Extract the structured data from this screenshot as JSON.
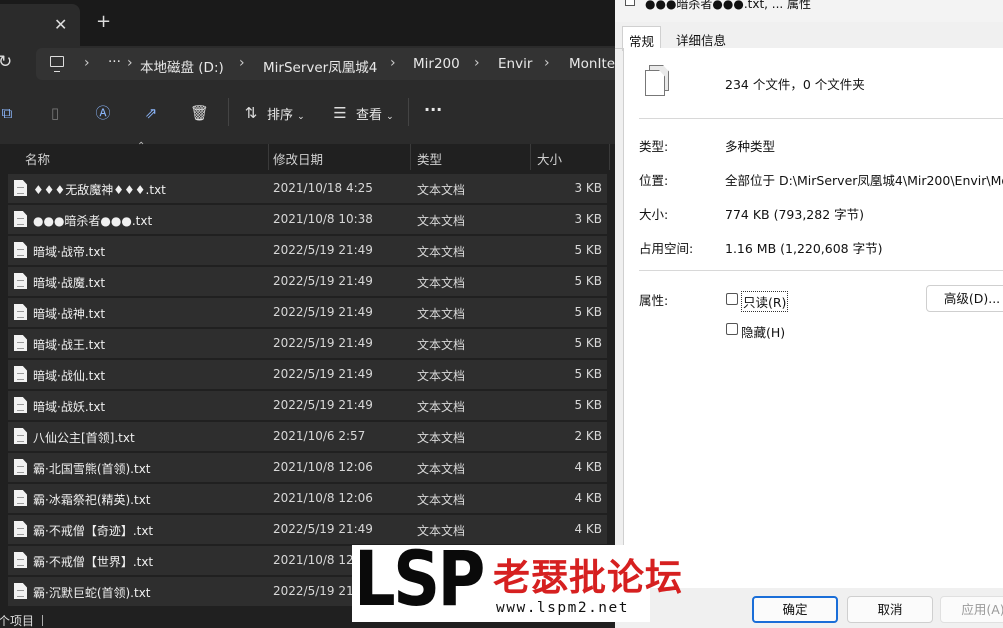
{
  "explorer": {
    "tab": {
      "close_glyph": "✕",
      "new_tab_glyph": "+"
    },
    "address": {
      "refresh_glyph": "↻",
      "more_glyph": "···",
      "crumbs": [
        "本地磁盘 (D:)",
        "MirServer凤凰城4",
        "Mir200",
        "Envir",
        "MonIte"
      ],
      "sep_glyph": "›"
    },
    "toolbar": {
      "sort_label": "排序",
      "view_label": "查看",
      "more_glyph": "···"
    },
    "columns": {
      "name": "名称",
      "date": "修改日期",
      "type": "类型",
      "size": "大小"
    },
    "files": [
      {
        "name": "♦♦♦无敌魔神♦♦♦.txt",
        "date": "2021/10/18 4:25",
        "type": "文本文档",
        "size": "3 KB"
      },
      {
        "name": "●●●暗杀者●●●.txt",
        "date": "2021/10/8 10:38",
        "type": "文本文档",
        "size": "3 KB"
      },
      {
        "name": "暗域·战帝.txt",
        "date": "2022/5/19 21:49",
        "type": "文本文档",
        "size": "5 KB"
      },
      {
        "name": "暗域·战魔.txt",
        "date": "2022/5/19 21:49",
        "type": "文本文档",
        "size": "5 KB"
      },
      {
        "name": "暗域·战神.txt",
        "date": "2022/5/19 21:49",
        "type": "文本文档",
        "size": "5 KB"
      },
      {
        "name": "暗域·战王.txt",
        "date": "2022/5/19 21:49",
        "type": "文本文档",
        "size": "5 KB"
      },
      {
        "name": "暗域·战仙.txt",
        "date": "2022/5/19 21:49",
        "type": "文本文档",
        "size": "5 KB"
      },
      {
        "name": "暗域·战妖.txt",
        "date": "2022/5/19 21:49",
        "type": "文本文档",
        "size": "5 KB"
      },
      {
        "name": "八仙公主[首领].txt",
        "date": "2021/10/6 2:57",
        "type": "文本文档",
        "size": "2 KB"
      },
      {
        "name": "霸·北国雪熊(首领).txt",
        "date": "2021/10/8 12:06",
        "type": "文本文档",
        "size": "4 KB"
      },
      {
        "name": "霸·冰霜祭祀(精英).txt",
        "date": "2021/10/8 12:06",
        "type": "文本文档",
        "size": "4 KB"
      },
      {
        "name": "霸·不戒僧【奇迹】.txt",
        "date": "2022/5/19 21:49",
        "type": "文本文档",
        "size": "4 KB"
      },
      {
        "name": "霸·不戒僧【世界】.txt",
        "date": "2021/10/8 12",
        "type": "",
        "size": ""
      },
      {
        "name": "霸·沉默巨蛇(首领).txt",
        "date": "2022/5/19 21",
        "type": "",
        "size": ""
      }
    ],
    "status": "个项目"
  },
  "dialog": {
    "title": "●●●暗杀者●●●.txt, ... 属性",
    "tabs": [
      "常规",
      "详细信息"
    ],
    "file_count": "234 个文件，0 个文件夹",
    "props": {
      "type_label": "类型:",
      "type_value": "多种类型",
      "location_label": "位置:",
      "location_value": "全部位于 D:\\MirServer凤凰城4\\Mir200\\Envir\\Mon",
      "size_label": "大小:",
      "size_value": "774 KB (793,282 字节)",
      "disk_label": "占用空间:",
      "disk_value": "1.16 MB (1,220,608 字节)",
      "attr_label": "属性:"
    },
    "readonly_label": "只读(R)",
    "hidden_label": "隐藏(H)",
    "advanced_label": "高级(D)...",
    "ok_label": "确定",
    "cancel_label": "取消",
    "apply_label": "应用(A)"
  },
  "watermark": {
    "logo_text": "LSP",
    "site_name": "老瑟批论坛",
    "url": "www.lspm2.net"
  }
}
